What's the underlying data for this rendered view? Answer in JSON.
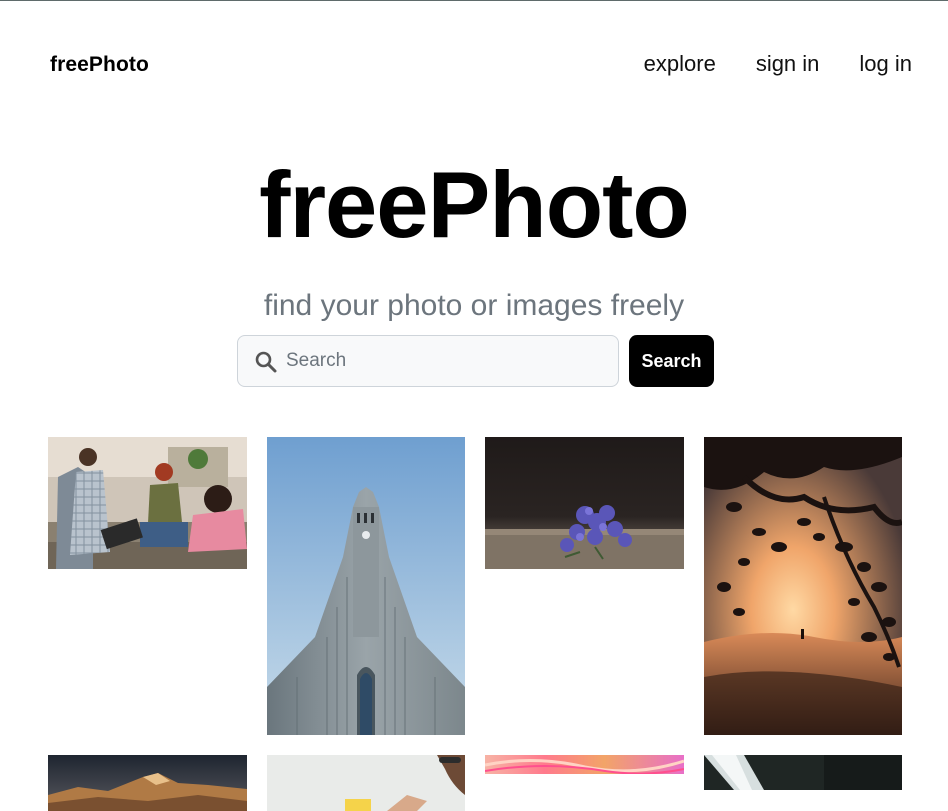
{
  "navbar": {
    "brand": "freePhoto",
    "links": [
      {
        "label": "explore"
      },
      {
        "label": "sign in"
      },
      {
        "label": "log in"
      }
    ]
  },
  "hero": {
    "title": "freePhoto",
    "subtitle": "find your photo or images freely"
  },
  "search": {
    "placeholder": "Search",
    "value": "",
    "button_label": "Search",
    "icon": "search-icon"
  },
  "gallery": {
    "photos": [
      {
        "subject": "friends chatting around a kitchen table"
      },
      {
        "subject": "tall concrete church tower against blue sky"
      },
      {
        "subject": "small purple flowers on a wooden surface"
      },
      {
        "subject": "silhouetted tree branches at desert sunset"
      },
      {
        "subject": "sunlit mountain peaks"
      },
      {
        "subject": "person holding a yellow note"
      },
      {
        "subject": "pink and orange abstract swirls"
      },
      {
        "subject": "dark interior with light beam"
      }
    ]
  },
  "colors": {
    "brand_text": "#000000",
    "subtitle": "#6c757d",
    "button_bg": "#000000",
    "input_bg": "#f8f9fa",
    "input_border": "#ced4da"
  }
}
